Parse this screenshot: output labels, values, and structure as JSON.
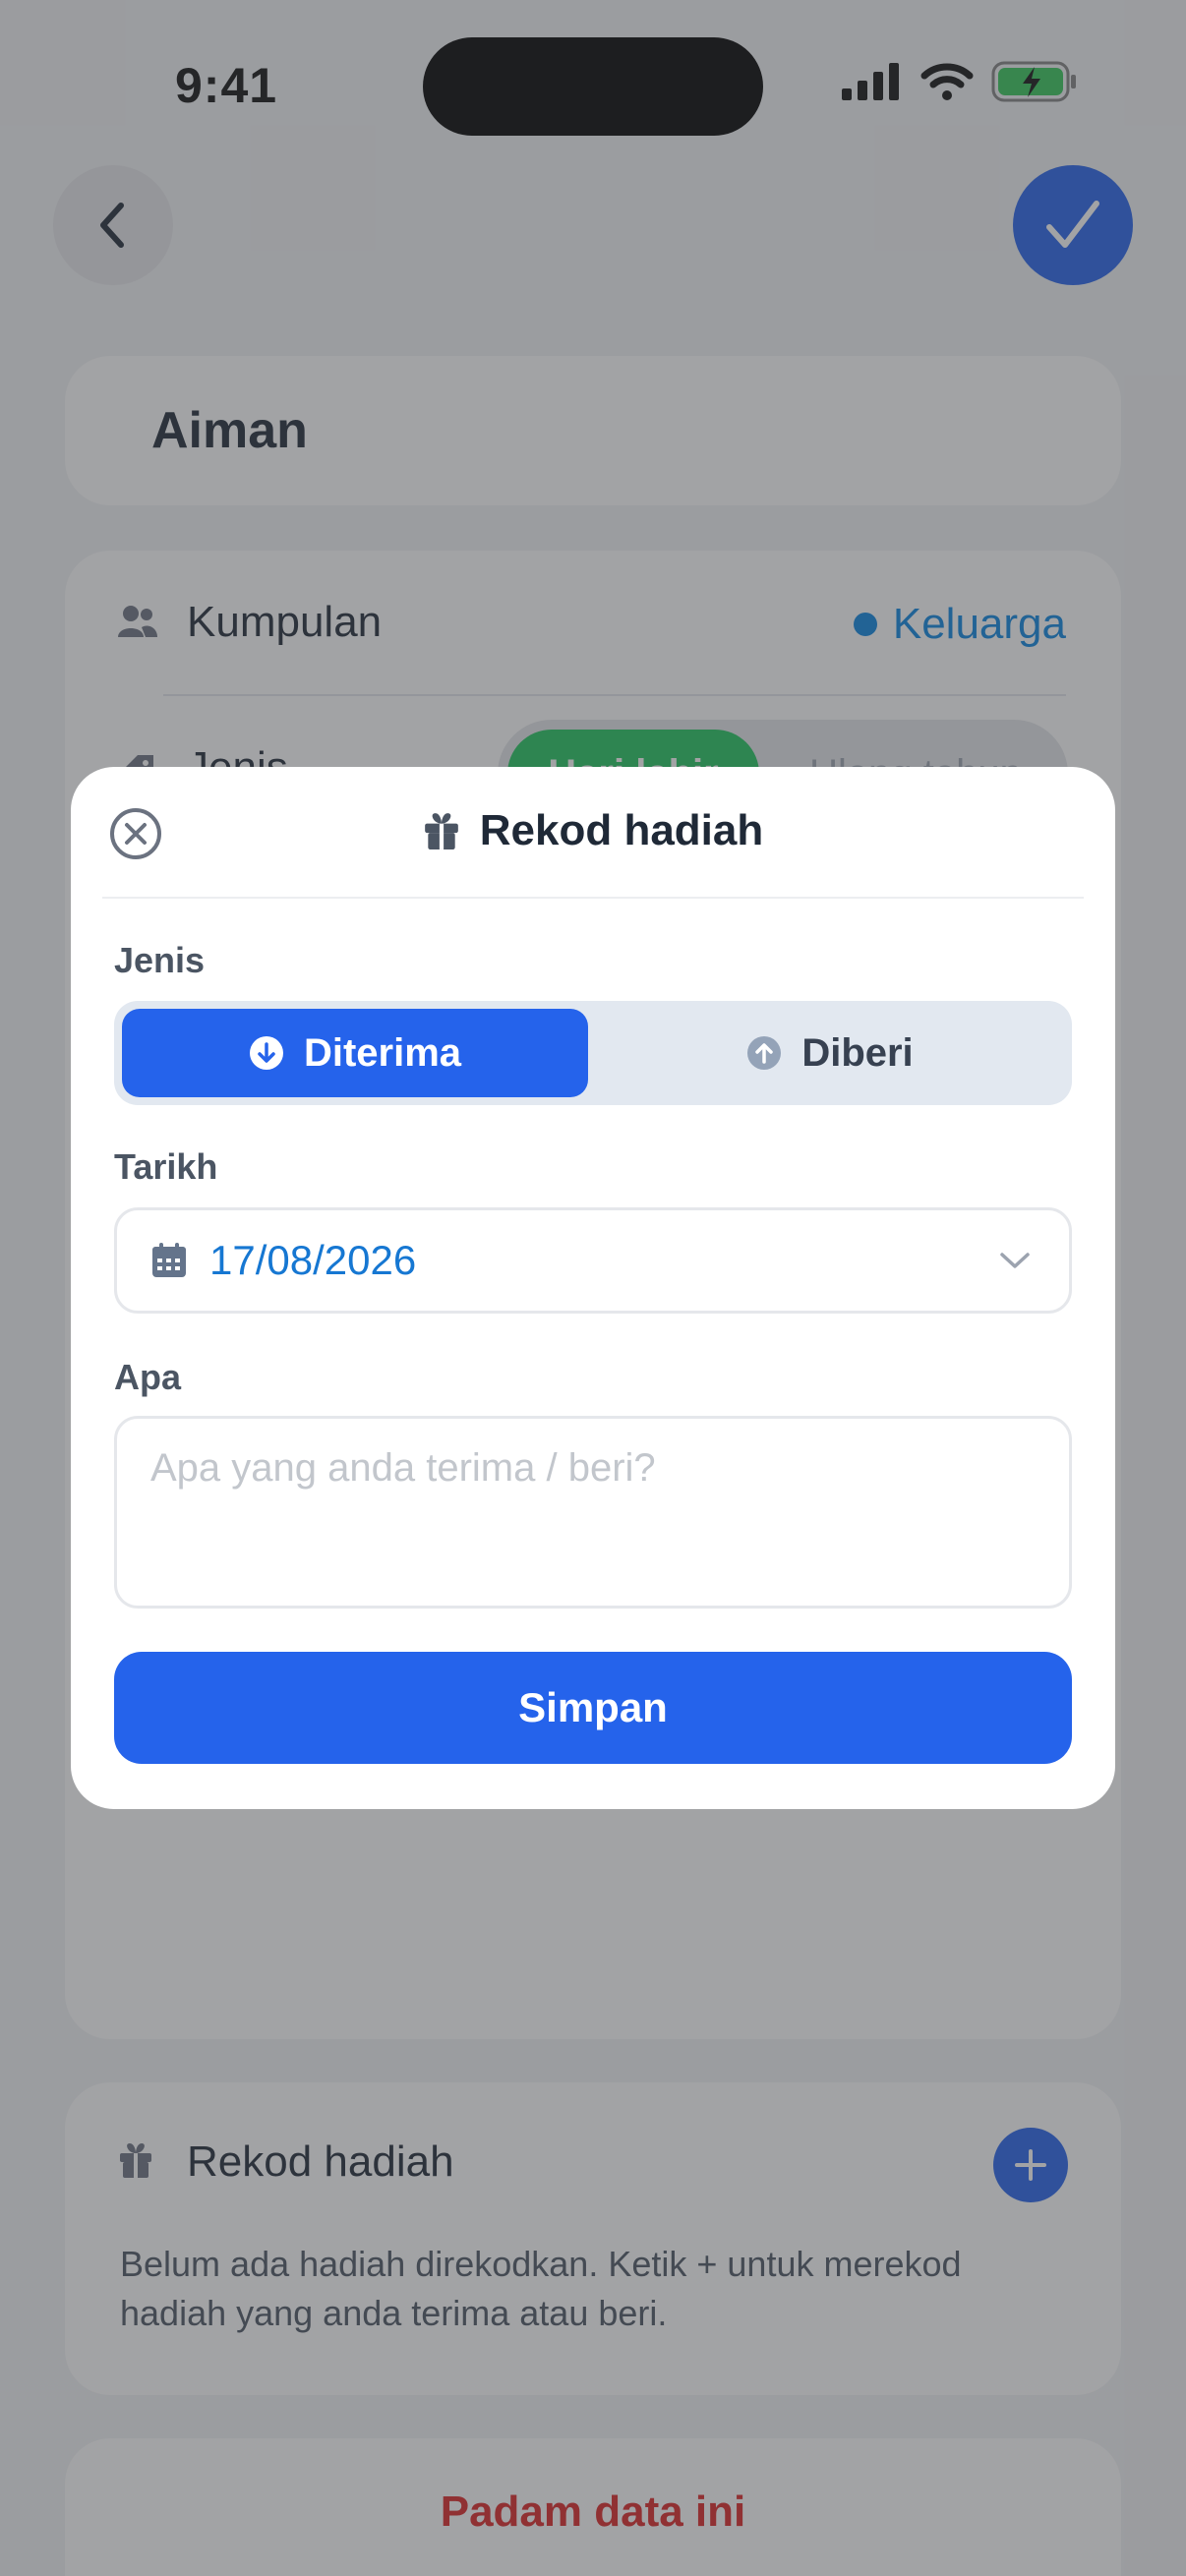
{
  "status_bar": {
    "time": "9:41"
  },
  "background": {
    "name": "Aiman",
    "group_label": "Kumpulan",
    "group_value": "Keluarga",
    "type_label": "Jenis",
    "type_options": [
      "Hari lahir",
      "Ulang tahun"
    ],
    "gift_section_title": "Rekod hadiah",
    "gift_empty_text": "Belum ada hadiah direkodkan. Ketik + untuk merekod hadiah yang anda terima atau beri.",
    "delete_label": "Padam data ini"
  },
  "modal": {
    "title": "Rekod hadiah",
    "type_label": "Jenis",
    "type_options": {
      "received": "Diterima",
      "given": "Diberi",
      "selected": "Diterima"
    },
    "date_label": "Tarikh",
    "date_value": "17/08/2026",
    "what_label": "Apa",
    "what_placeholder": "Apa yang anda terima / beri?",
    "save_label": "Simpan"
  },
  "colors": {
    "accent": "#2563eb",
    "link": "#0b84e0",
    "success": "#22c55e",
    "danger": "#dc2626"
  },
  "icons": [
    "back-chevron-icon",
    "checkmark-icon",
    "people-icon",
    "tag-icon",
    "gift-icon",
    "plus-icon",
    "close-circle-icon",
    "arrow-down-circle-icon",
    "arrow-up-circle-icon",
    "calendar-icon",
    "chevron-down-icon",
    "signal-icon",
    "wifi-icon",
    "battery-charging-icon"
  ]
}
